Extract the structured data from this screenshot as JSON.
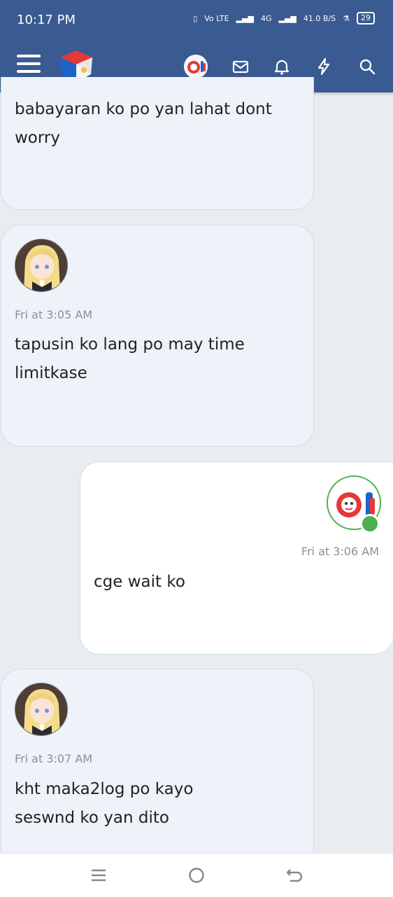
{
  "status_bar": {
    "time": "10:17 PM",
    "network": "Vo LTE",
    "network_gen": "4G",
    "speed": "41.0 B/S",
    "battery": "29"
  },
  "app_bar": {
    "icons": [
      "menu-icon",
      "site-logo",
      "user-avatar",
      "mail-icon",
      "bell-icon",
      "bolt-icon",
      "search-icon"
    ],
    "colors": {
      "bar": "#3a5a92"
    }
  },
  "messages": [
    {
      "id": "m0",
      "sender": "other",
      "text_line1": "babayaran ko po yan lahat dont",
      "text_line2": "worry"
    },
    {
      "id": "m1",
      "sender": "other",
      "time": "Fri at 3:05 AM",
      "text_line1": "tapusin ko lang po may time",
      "text_line2": "limitkase"
    },
    {
      "id": "m2",
      "sender": "self",
      "time": "Fri at 3:06 AM",
      "text_line1": "cge wait ko"
    },
    {
      "id": "m3",
      "sender": "other",
      "time": "Fri at 3:07 AM",
      "text_line1": "kht maka2log po kayo",
      "text_line2": "seswnd ko yan dito"
    }
  ],
  "system_nav": {
    "icons": [
      "recents-icon",
      "home-icon",
      "back-icon"
    ]
  }
}
